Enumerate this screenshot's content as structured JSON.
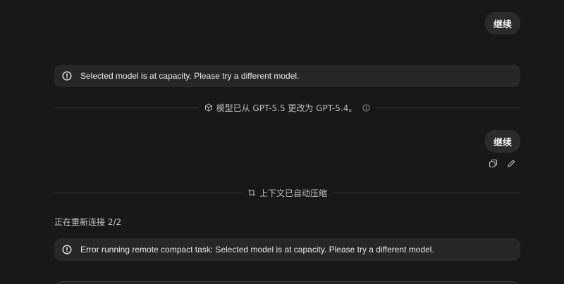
{
  "messages": {
    "user_1": "继续",
    "user_2": "继续"
  },
  "alerts": {
    "capacity": "Selected model is at capacity. Please try a different model.",
    "remote_compact": "Error running remote compact task: Selected model is at capacity. Please try a different model."
  },
  "dividers": {
    "model_change": "模型已从 GPT-5.5 更改为 GPT-5.4。",
    "context_compressed": "上下文已自动压缩"
  },
  "status": {
    "reconnecting": "正在重新连接 2/2"
  },
  "icons": {
    "alert": "alert-circle-icon",
    "model": "cube-icon",
    "info": "info-icon",
    "compress": "compress-icon",
    "copy": "copy-icon",
    "edit": "pencil-icon"
  },
  "colors": {
    "background": "#181818",
    "bubble": "#2b2b2b",
    "alert_bg": "#272727",
    "divider_line": "#2f2f2f"
  }
}
